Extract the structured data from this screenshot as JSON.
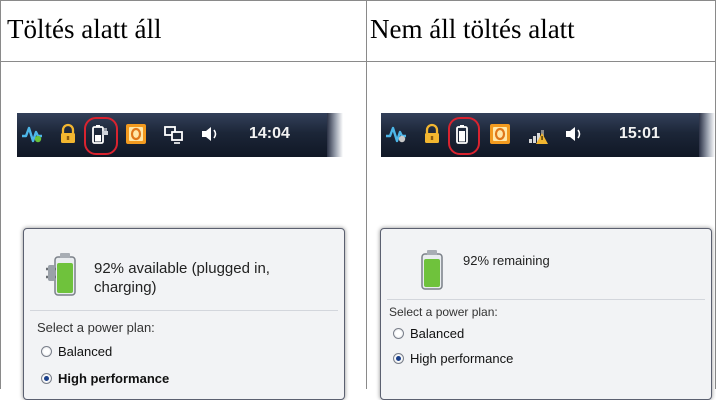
{
  "headers": {
    "charging": "Töltés alatt áll",
    "not_charging": "Nem áll töltés alatt"
  },
  "left": {
    "taskbar": {
      "clock": "14:04",
      "icons": [
        "network-activity-icon",
        "lock-icon",
        "battery-plugged-icon",
        "office-icon",
        "network-computer-icon",
        "speaker-icon"
      ]
    },
    "popup": {
      "status": "92% available (plugged in, charging)",
      "status_line1": "92% available (plugged in,",
      "status_line2": "charging)",
      "plan_label": "Select a power plan:",
      "plans": [
        {
          "label": "Balanced",
          "selected": false
        },
        {
          "label": "High performance",
          "selected": true
        }
      ]
    }
  },
  "right": {
    "taskbar": {
      "clock": "15:01",
      "icons": [
        "network-activity-icon",
        "lock-icon",
        "battery-icon",
        "office-icon",
        "wireless-signal-warning-icon",
        "speaker-icon"
      ]
    },
    "popup": {
      "status": "92% remaining",
      "plan_label": "Select a power plan:",
      "plans": [
        {
          "label": "Balanced",
          "selected": false
        },
        {
          "label": "High performance",
          "selected": true
        }
      ]
    }
  },
  "colors": {
    "taskbar": "#1c2638",
    "lock": "#f2b630",
    "office": "#f29a1f",
    "battery": "#6fc23c",
    "highlight": "#d9232f"
  }
}
